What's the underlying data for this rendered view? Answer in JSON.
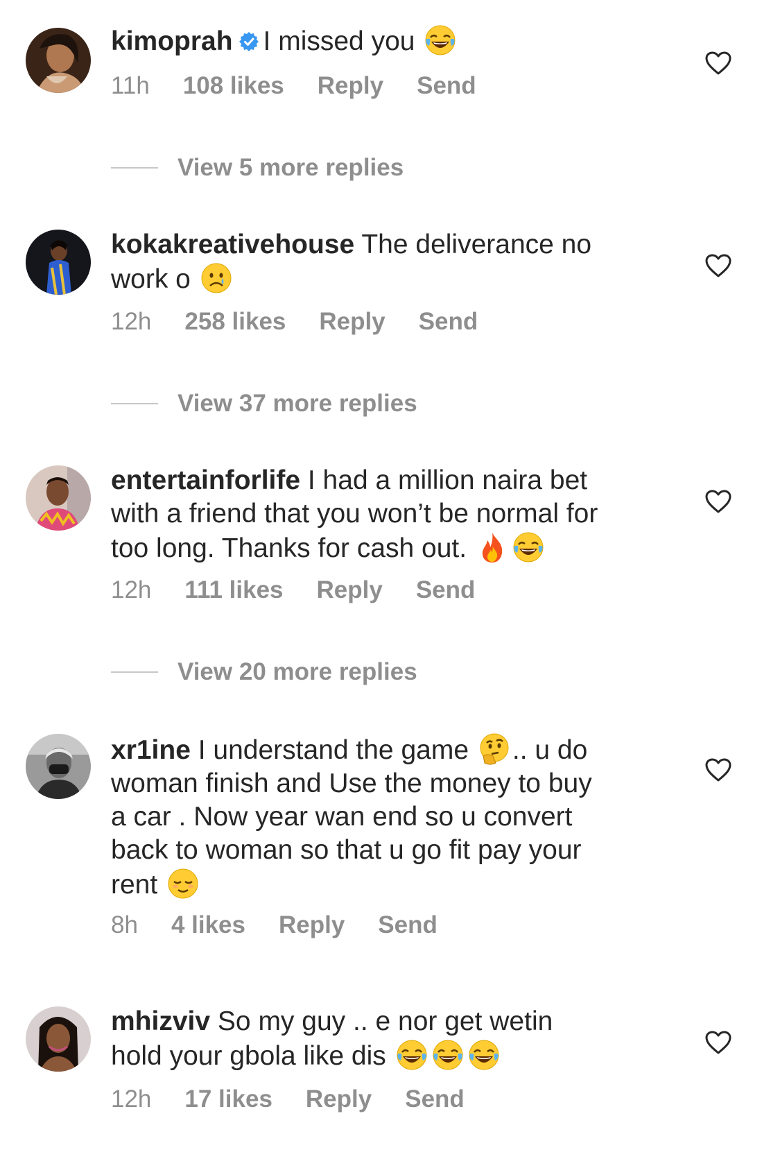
{
  "comments": [
    {
      "username": "kimoprah",
      "verified": true,
      "text": "I missed you",
      "time": "11h",
      "likes": "108 likes",
      "reply": "Reply",
      "send": "Send",
      "view_replies": "View 5 more replies"
    },
    {
      "username": "kokakreativehouse",
      "text_line1": "The deliverance no",
      "text_line2": "work o",
      "time": "12h",
      "likes": "258 likes",
      "reply": "Reply",
      "send": "Send",
      "view_replies": "View 37 more replies"
    },
    {
      "username": "entertainforlife",
      "text_line1": "I had a million naira bet",
      "text_line2": "with a friend that you won’t be normal for",
      "text_line3": "too long. Thanks for cash out.",
      "time": "12h",
      "likes": "111 likes",
      "reply": "Reply",
      "send": "Send",
      "view_replies": "View 20 more replies"
    },
    {
      "username": "xr1ine",
      "text_line1a": "I understand the game",
      "text_line1b": ".. u do",
      "text_line2": "woman finish and Use the money to buy",
      "text_line3": "a car . Now year wan end so u convert",
      "text_line4": "back to woman so that u go fit pay your",
      "text_line5": "rent",
      "time": "8h",
      "likes": "4 likes",
      "reply": "Reply",
      "send": "Send"
    },
    {
      "username": "mhizviv",
      "text_line1": "So my guy .. e nor get wetin",
      "text_line2": "hold your gbola like dis",
      "time": "12h",
      "likes": "17 likes",
      "reply": "Reply",
      "send": "Send"
    }
  ],
  "icons": {
    "heart": "heart-outline-icon",
    "verified": "verified-badge-icon",
    "laugh": "face-with-tears-of-joy-emoji",
    "cry": "crying-face-emoji",
    "fire": "fire-emoji",
    "think": "thinking-face-emoji",
    "relieved": "relieved-face-emoji"
  },
  "colors": {
    "text": "#262626",
    "meta": "#8e8e8e",
    "verified": "#3897f0",
    "divider": "#c7c7c7"
  }
}
